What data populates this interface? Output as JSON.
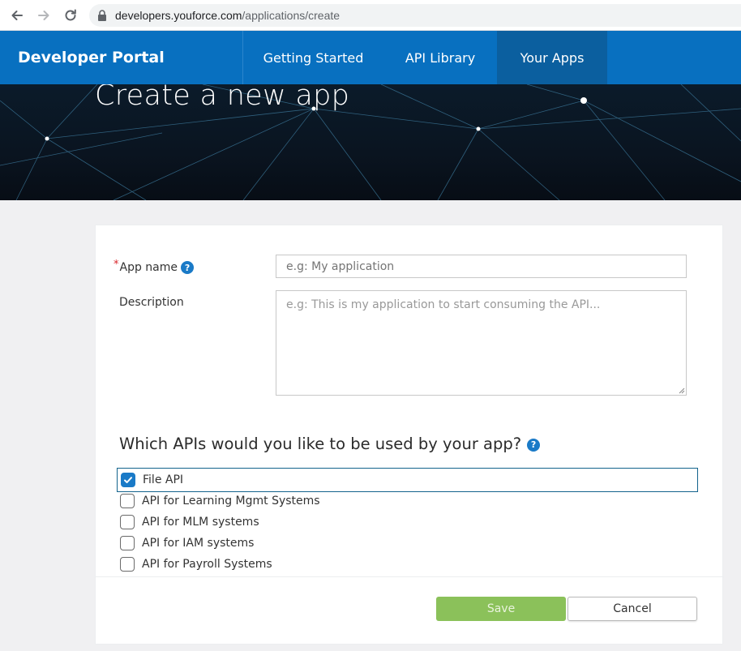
{
  "browser": {
    "url_host": "developers.youforce.com",
    "url_path": "/applications/create"
  },
  "header": {
    "brand": "Developer Portal",
    "nav": [
      {
        "label": "Getting Started",
        "active": false
      },
      {
        "label": "API Library",
        "active": false
      },
      {
        "label": "Your Apps",
        "active": true
      }
    ]
  },
  "hero": {
    "title": "Create a new app"
  },
  "form": {
    "app_name": {
      "required_mark": "*",
      "label": "App name",
      "help": "?",
      "placeholder": "e.g: My application",
      "value": ""
    },
    "description": {
      "label": "Description",
      "placeholder": "e.g: This is my application to start consuming the API...",
      "value": ""
    },
    "apis_section": {
      "title": "Which APIs would you like to be used by your app?",
      "help": "?",
      "options": [
        {
          "label": "File API",
          "checked": true,
          "focused": true
        },
        {
          "label": "API for Learning Mgmt Systems",
          "checked": false
        },
        {
          "label": "API for MLM systems",
          "checked": false
        },
        {
          "label": "API for IAM systems",
          "checked": false
        },
        {
          "label": "API for Payroll Systems",
          "checked": false
        }
      ]
    },
    "buttons": {
      "save": "Save",
      "cancel": "Cancel"
    }
  },
  "colors": {
    "header_bg": "#0870c0",
    "active_nav_bg": "#0b5f9f",
    "accent": "#1a7ac7",
    "save_bg": "#8bc15a"
  }
}
